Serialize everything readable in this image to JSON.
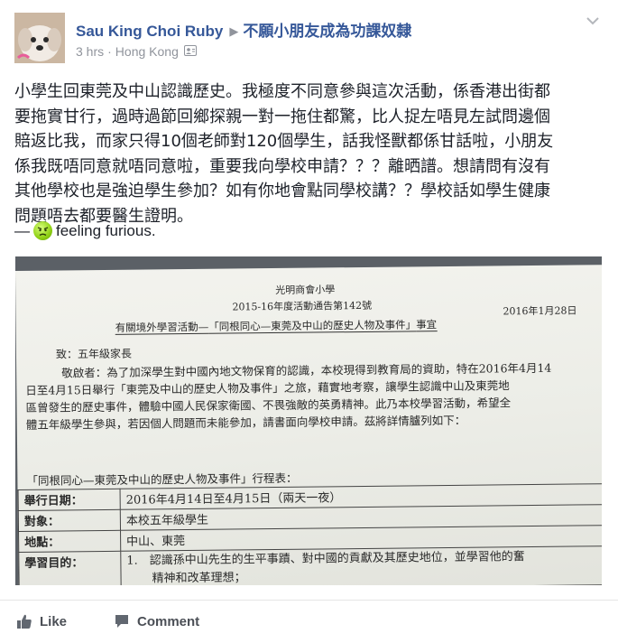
{
  "post": {
    "author": "Sau King Choi Ruby",
    "group": "不願小朋友成為功課奴隸",
    "time": "3 hrs",
    "separator": "·",
    "location": "Hong Kong",
    "privacy_icon": "friends-icon",
    "body_lines": [
      "小學生回東莞及中山認識歷史。我極度不同意參與這次活動，係香港出街都",
      "要拖實甘行，過時過節回鄉探親一對一拖住都驚，比人捉左唔見左試問邊個",
      "賠返比我，而家只得10個老師對120個學生，話我怪獸都係甘話啦，小朋友",
      "係我既唔同意就唔同意啦，重要我向學校申請？？？離晒譜。想請問有沒有",
      "其他學校也是強迫學生參加？如有你地會點同學校講？？學校話如學生健康",
      "問題唔去都要醫生證明。"
    ],
    "feeling_dash": "—",
    "feeling": "feeling furious."
  },
  "document": {
    "school": "光明商會小學",
    "notice_no": "2015-16年度活動通告第142號",
    "date": "2016年1月28日",
    "heading_prefix": "有關境外學習活動—",
    "heading_main": "「同根同心—東莞及中山的歷史人物及事件」",
    "heading_suffix": "事宜",
    "to": "致：五年級家長",
    "para": [
      "敬啟者：為了加深學生對中國內地文物保育的認識，本校現得到教育局的資助，特在2016年4月14",
      "日至4月15日舉行「東莞及中山的歷史人物及事件」之旅，藉實地考察，讓學生認識中山及東莞地",
      "區曾發生的歷史事件，體驗中國人民保家衛國、不畏強敵的英勇精神。此乃本校學習活動，希望全",
      "體五年級學生參與，若因個人問題而未能參加，請書面向學校申請。茲將詳情臚列如下："
    ],
    "underline_1": "此乃本校學習活動，希望全",
    "underline_2": "體五年級學生參與",
    "underline_3": "請書面向學校申請",
    "table_title": "「同根同心—東莞及中山的歷史人物及事件」行程表：",
    "rows": [
      {
        "key": "舉行日期：",
        "value": "2016年4月14日至4月15日（兩天一夜）"
      },
      {
        "key": "對象：",
        "value": "本校五年級學生"
      },
      {
        "key": "地點：",
        "value": "中山、東莞"
      },
      {
        "key": "學習目的：",
        "value": "1.　認識孫中山先生的生平事蹟、對中國的貢獻及其歷史地位，並學習他的奮",
        "value2": "精神和改革理想；"
      }
    ]
  },
  "actions": {
    "like": "Like",
    "comment": "Comment"
  },
  "colors": {
    "link": "#365899",
    "meta": "#90949c",
    "text": "#1d2129",
    "action": "#4b4f56"
  }
}
